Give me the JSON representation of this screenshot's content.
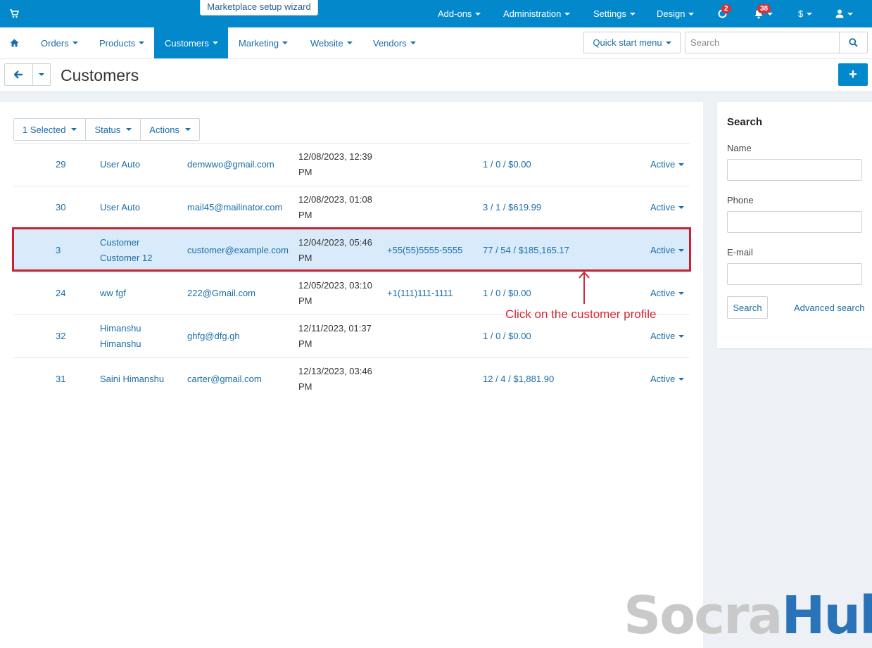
{
  "topbar": {
    "wizard": "Marketplace setup wizard",
    "items": [
      "Add-ons",
      "Administration",
      "Settings",
      "Design"
    ],
    "badge_updates": "2",
    "badge_notifications": "38",
    "currency": "$"
  },
  "nav": {
    "items": [
      "Orders",
      "Products",
      "Customers",
      "Marketing",
      "Website",
      "Vendors"
    ],
    "active": "Customers",
    "quick_start": "Quick start menu",
    "search_placeholder": "Search"
  },
  "page": {
    "title": "Customers"
  },
  "actions": {
    "selected": "1 Selected",
    "status": "Status",
    "actions": "Actions"
  },
  "customers": [
    {
      "id": "29",
      "name": "User Auto",
      "email": "demwwo@gmail.com",
      "date": "12/08/2023, 12:39 PM",
      "phone": "",
      "orders": "1 / 0 / $0.00",
      "status": "Active",
      "selected": false
    },
    {
      "id": "30",
      "name": "User Auto",
      "email": "mail45@mailinator.com",
      "date": "12/08/2023, 01:08 PM",
      "phone": "",
      "orders": "3 / 1 / $619.99",
      "status": "Active",
      "selected": false
    },
    {
      "id": "3",
      "name": "Customer Customer 12",
      "email": "customer@example.com",
      "date": "12/04/2023, 05:46 PM",
      "phone": "+55(55)5555-5555",
      "orders": "77 / 54 / $185,165.17",
      "status": "Active",
      "selected": true
    },
    {
      "id": "24",
      "name": "ww fgf",
      "email": "222@Gmail.com",
      "date": "12/05/2023, 03:10 PM",
      "phone": "+1(111)111-1111",
      "orders": "1 / 0 / $0.00",
      "status": "Active",
      "selected": false
    },
    {
      "id": "32",
      "name": "Himanshu Himanshu",
      "email": "ghfg@dfg.gh",
      "date": "12/11/2023, 01:37 PM",
      "phone": "",
      "orders": "1 / 0 / $0.00",
      "status": "Active",
      "selected": false
    },
    {
      "id": "31",
      "name": "Saini Himanshu",
      "email": "carter@gmail.com",
      "date": "12/13/2023, 03:46 PM",
      "phone": "",
      "orders": "12 / 4 / $1,881.90",
      "status": "Active",
      "selected": false
    }
  ],
  "annotation": {
    "text": "Click on the customer profile"
  },
  "sidebar": {
    "title": "Search",
    "name_label": "Name",
    "phone_label": "Phone",
    "email_label": "E-mail",
    "search_button": "Search",
    "advanced_link": "Advanced search"
  },
  "watermark": {
    "part1": "Socra",
    "part2": "Hub"
  },
  "colors": {
    "primary": "#0388cc",
    "link": "#1a6ea8",
    "highlight": "#c52232",
    "selected_row": "#d9ebfa"
  }
}
